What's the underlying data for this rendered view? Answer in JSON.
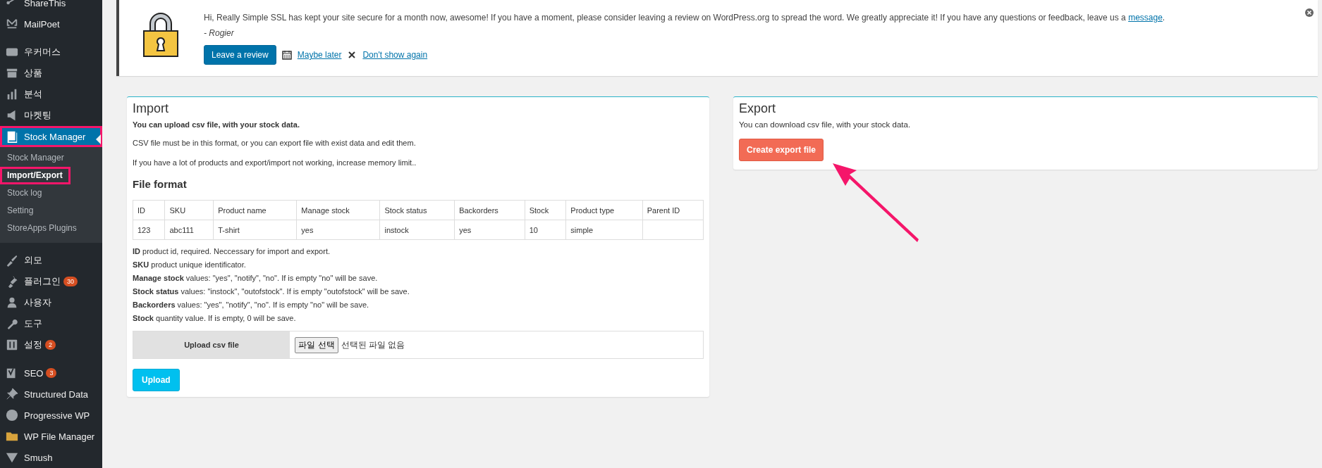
{
  "sidebar": {
    "sections": [
      {
        "items": [
          {
            "label": "ShareThis",
            "selected": false,
            "highlighted": false
          },
          {
            "label": "MailPoet",
            "selected": false,
            "highlighted": false
          }
        ]
      },
      {
        "items": [
          {
            "label": "우커머스",
            "selected": false,
            "highlighted": false
          },
          {
            "label": "상품",
            "selected": false,
            "highlighted": false
          },
          {
            "label": "분석",
            "selected": false,
            "highlighted": false
          },
          {
            "label": "마켓팅",
            "selected": false,
            "highlighted": false
          },
          {
            "label": "Stock Manager",
            "selected": true,
            "highlighted": true,
            "children": [
              {
                "label": "Stock Manager",
                "selected": false,
                "highlighted": false
              },
              {
                "label": "Import/Export",
                "selected": true,
                "highlighted": true
              },
              {
                "label": "Stock log",
                "selected": false,
                "highlighted": false
              },
              {
                "label": "Setting",
                "selected": false,
                "highlighted": false
              },
              {
                "label": "StoreApps Plugins",
                "selected": false,
                "highlighted": false
              }
            ]
          }
        ]
      },
      {
        "items": [
          {
            "label": "외모",
            "selected": false,
            "highlighted": false
          },
          {
            "label": "플러그인",
            "badge": "30",
            "selected": false,
            "highlighted": false
          },
          {
            "label": "사용자",
            "selected": false,
            "highlighted": false
          },
          {
            "label": "도구",
            "selected": false,
            "highlighted": false
          },
          {
            "label": "설정",
            "badge": "2",
            "selected": false,
            "highlighted": false
          }
        ]
      },
      {
        "items": [
          {
            "label": "SEO",
            "badge": "3",
            "selected": false,
            "highlighted": false
          },
          {
            "label": "Structured Data",
            "selected": false,
            "highlighted": false
          },
          {
            "label": "Progressive WP",
            "selected": false,
            "highlighted": false
          },
          {
            "label": "WP File Manager",
            "selected": false,
            "highlighted": false
          },
          {
            "label": "Smush",
            "selected": false,
            "highlighted": false
          }
        ]
      }
    ]
  },
  "notice": {
    "text": "Hi, Really Simple SSL has kept your site secure for a month now, awesome! If you have a moment, please consider leaving a review on WordPress.org to spread the word. We greatly appreciate it! If you have any questions or feedback, leave us a ",
    "link": "message",
    "text_end": ".",
    "signature": "- Rogier",
    "review_button": "Leave a review",
    "maybe_later": "Maybe later",
    "dont_show": "Don't show again"
  },
  "import": {
    "title": "Import",
    "lead": "You can upload csv file, with your stock data.",
    "paragraphs": [
      "CSV file must be in this format, or you can export file with exist data and edit them.",
      "If you have a lot of products and export/import not working, increase memory limit.."
    ],
    "format_title": "File format",
    "table": {
      "columns": [
        "ID",
        "SKU",
        "Product name",
        "Manage stock",
        "Stock status",
        "Backorders",
        "Stock",
        "Product type",
        "Parent ID"
      ],
      "rows": [
        [
          "123",
          "abc111",
          "T-shirt",
          "yes",
          "instock",
          "yes",
          "10",
          "simple",
          ""
        ]
      ]
    },
    "notes": [
      "**ID** product id, required. Neccessary for import and export.",
      "**SKU** product unique identificator.",
      "**Manage stock** values: \"yes\", \"notify\", \"no\". If is empty \"no\" will be save.",
      "**Stock status** values: \"instock\", \"outofstock\". If is empty \"outofstock\" will be save.",
      "**Backorders** values: \"yes\", \"notify\", \"no\". If is empty \"no\" will be save.",
      "**Stock** quantity value. If is empty, 0 will be save."
    ],
    "upload_label": "Upload csv file",
    "file_button": "파일 선택",
    "file_status": "선택된 파일 없음",
    "upload_button": "Upload"
  },
  "export": {
    "title": "Export",
    "lead": "You can download csv file, with your stock data.",
    "button": "Create export file"
  }
}
